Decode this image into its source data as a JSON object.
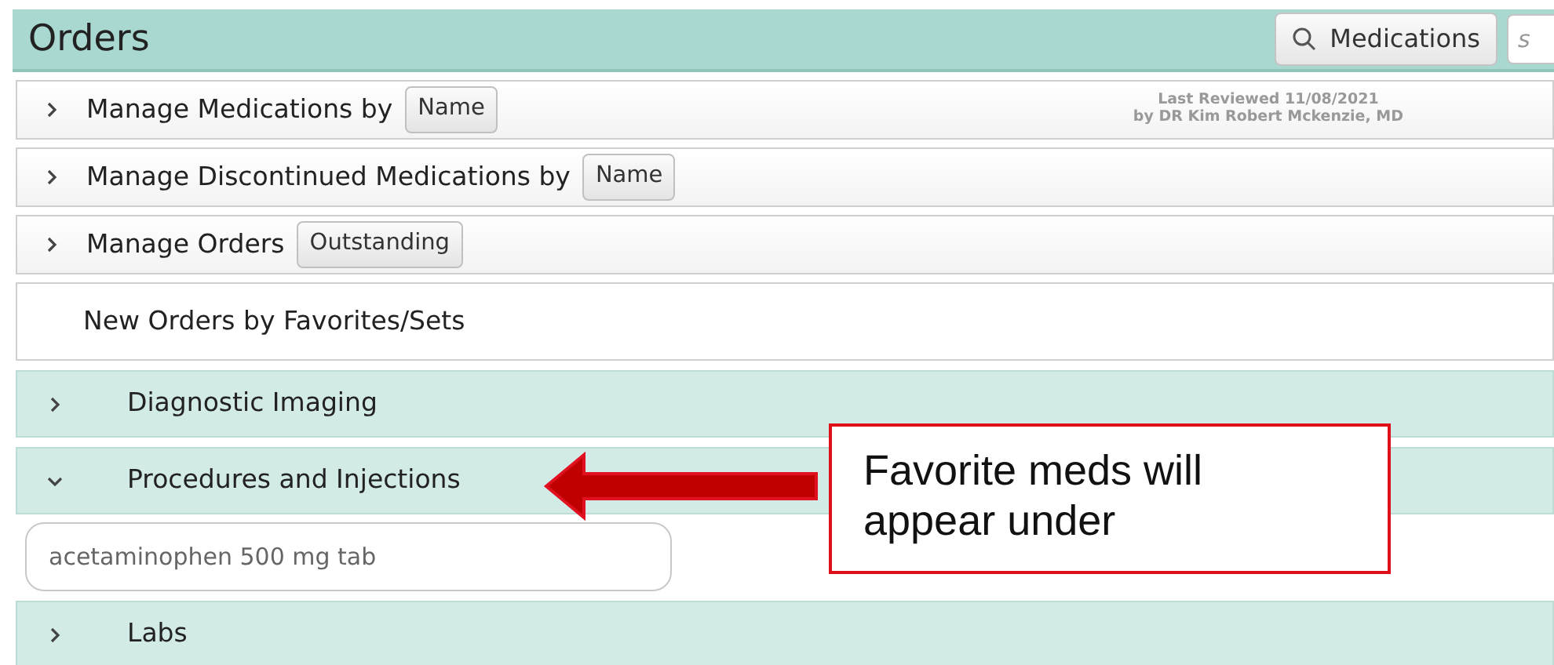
{
  "header": {
    "title": "Orders",
    "search_button": "Medications",
    "search_field": {
      "placeholder": "s"
    }
  },
  "rows": [
    {
      "kind": "manage",
      "label": "Manage Medications by",
      "button": "Name",
      "expanded": false,
      "note": [
        "Last Reviewed 11/08/2021",
        "by DR Kim Robert Mckenzie, MD"
      ]
    },
    {
      "kind": "manage",
      "label": "Manage Discontinued Medications by",
      "button": "Name",
      "expanded": false
    },
    {
      "kind": "manage",
      "label": "Manage Orders",
      "button": "Outstanding",
      "expanded": false
    },
    {
      "kind": "plain",
      "label": "New Orders by Favorites/Sets"
    },
    {
      "kind": "category",
      "label": "Diagnostic Imaging",
      "expanded": false
    },
    {
      "kind": "category",
      "label": "Procedures and Injections",
      "expanded": true
    },
    {
      "kind": "favorite",
      "label": "acetaminophen 500 mg tab"
    },
    {
      "kind": "category",
      "label": "Labs",
      "expanded": false
    }
  ],
  "callout": {
    "text": "Favorite meds will appear under"
  }
}
